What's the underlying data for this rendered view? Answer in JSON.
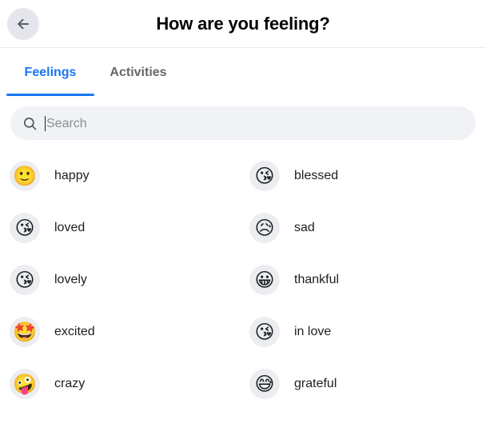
{
  "header": {
    "title": "How are you feeling?",
    "back_icon": "arrow-left-icon",
    "back_label": "Back"
  },
  "tabs": [
    {
      "label": "Feelings",
      "active": true
    },
    {
      "label": "Activities",
      "active": false
    }
  ],
  "search": {
    "icon": "search-icon",
    "placeholder": "Search",
    "value": "",
    "focused": true
  },
  "colors": {
    "accent": "#1877f2",
    "tab_inactive": "#65676b",
    "search_bg": "#f0f2f5",
    "emoji_bg": "#ebedf0",
    "back_bg": "#e4e6eb",
    "text": "#1c1e21",
    "title": "#050505",
    "divider": "#e9ebee",
    "placeholder": "#8a8d91"
  },
  "feelings": [
    {
      "emoji": "🙂",
      "label": "happy",
      "icon_name": "slightly-smiling-face-emoji"
    },
    {
      "emoji": "😘",
      "label": "blessed",
      "icon_name": "smiling-face-with-halo-emoji"
    },
    {
      "emoji": "😘",
      "label": "loved",
      "icon_name": "face-blowing-a-kiss-emoji"
    },
    {
      "emoji": "😥",
      "label": "sad",
      "icon_name": "sad-but-relieved-face-emoji"
    },
    {
      "emoji": "😘",
      "label": "lovely",
      "icon_name": "face-blowing-a-kiss-emoji"
    },
    {
      "emoji": "😀",
      "label": "thankful",
      "icon_name": "grinning-face-emoji"
    },
    {
      "emoji": "🤩",
      "label": "excited",
      "icon_name": "star-struck-emoji"
    },
    {
      "emoji": "😘",
      "label": "in love",
      "icon_name": "face-blowing-a-kiss-emoji"
    },
    {
      "emoji": "🤪",
      "label": "crazy",
      "icon_name": "zany-face-emoji"
    },
    {
      "emoji": "😅",
      "label": "grateful",
      "icon_name": "grinning-face-with-sweat-emoji"
    }
  ]
}
